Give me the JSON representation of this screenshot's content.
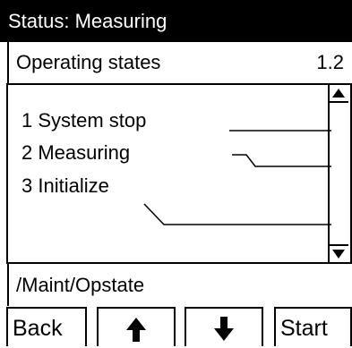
{
  "status_bar": {
    "text": "Status: Measuring"
  },
  "header": {
    "title": "Operating states",
    "value": "1.2"
  },
  "list": {
    "items": [
      {
        "label": "1  System stop"
      },
      {
        "label": "2  Measuring"
      },
      {
        "label": "3  Initialize"
      }
    ]
  },
  "path": {
    "text": "/Maint/Opstate"
  },
  "softkeys": {
    "back": "Back",
    "up_icon": "up-arrow",
    "down_icon": "down-arrow",
    "start": "Start"
  }
}
